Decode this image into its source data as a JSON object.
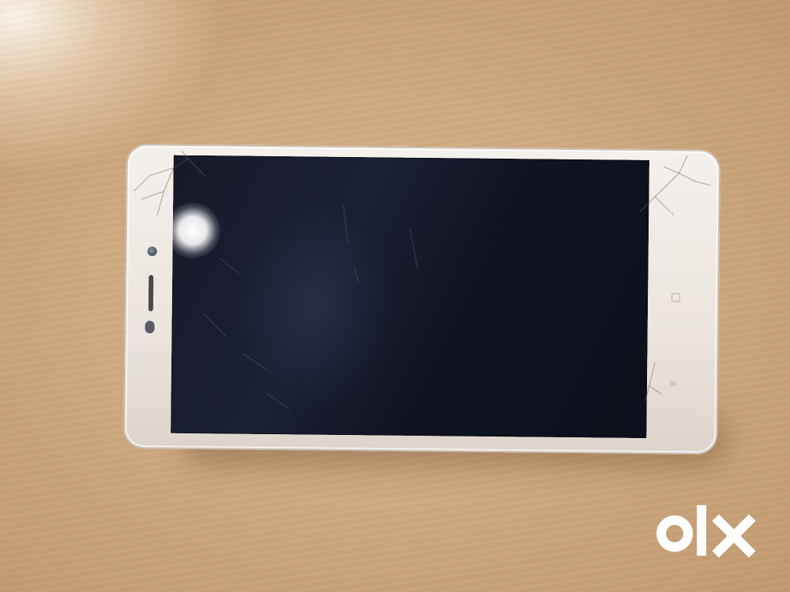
{
  "photo": {
    "subject_icon": "smartphone-icon",
    "colors": {
      "table_surface": "#cfa87f",
      "phone_frame": "#f0ebe6",
      "screen": "#141726",
      "watermark": "#ffffff"
    }
  },
  "watermark": {
    "brand": "olx"
  }
}
